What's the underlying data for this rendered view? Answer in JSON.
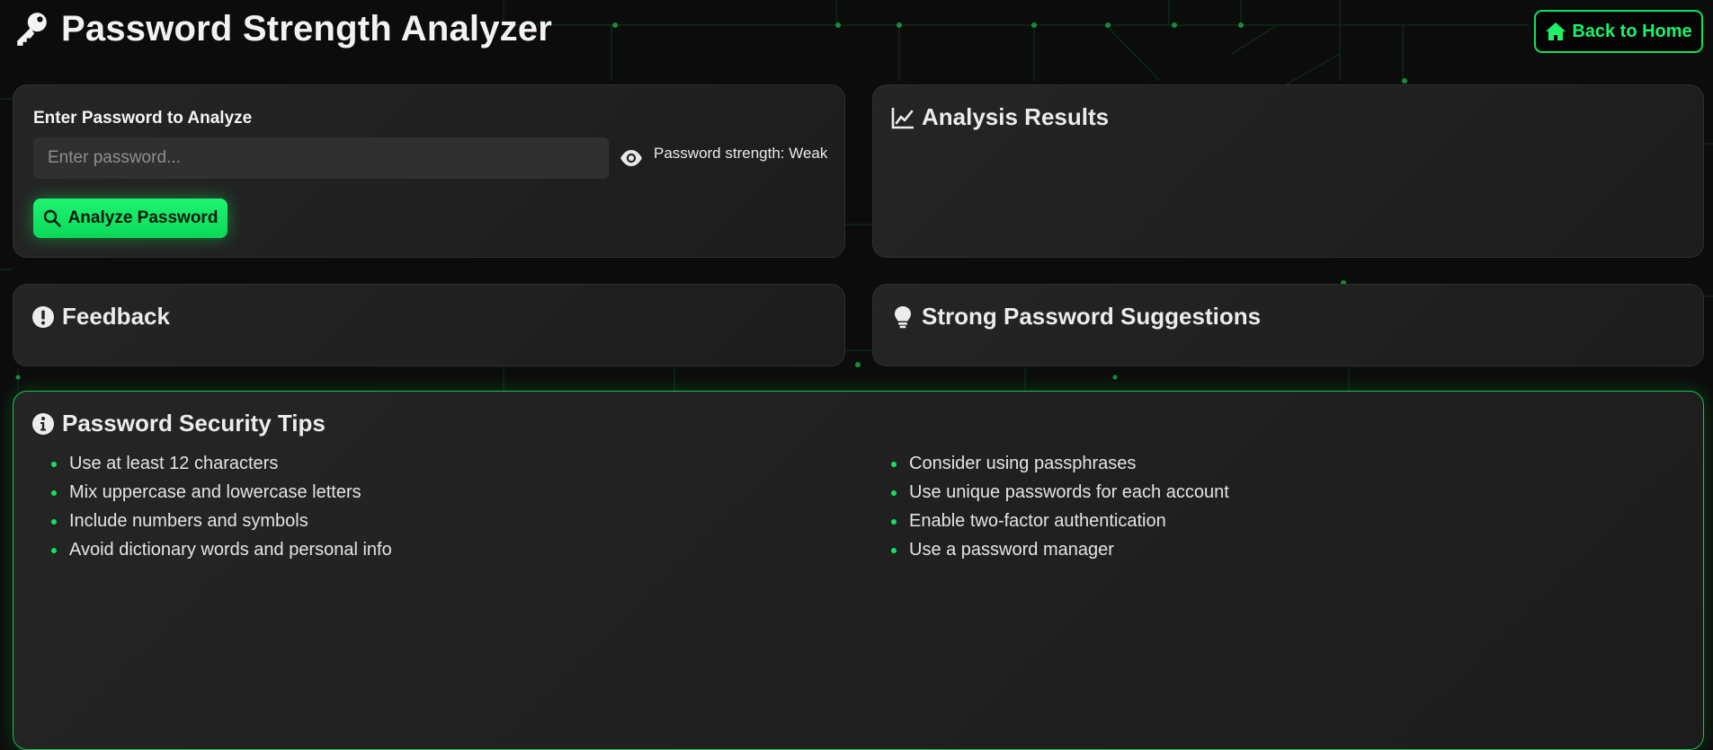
{
  "header": {
    "title": "Password Strength Analyzer",
    "back_label": "Back to Home",
    "accent_color": "#1ef06a"
  },
  "input_panel": {
    "label": "Enter Password to Analyze",
    "placeholder": "Enter password...",
    "value": "",
    "strength_text": "Password strength: Weak",
    "analyze_label": "Analyze Password"
  },
  "results": {
    "title": "Analysis Results"
  },
  "feedback": {
    "title": "Feedback"
  },
  "suggestions": {
    "title": "Strong Password Suggestions"
  },
  "tips": {
    "title": "Password Security Tips",
    "left": [
      "Use at least 12 characters",
      "Mix uppercase and lowercase letters",
      "Include numbers and symbols",
      "Avoid dictionary words and personal info"
    ],
    "right": [
      "Consider using passphrases",
      "Use unique passwords for each account",
      "Enable two-factor authentication",
      "Use a password manager"
    ]
  },
  "icons": {
    "title": "key-icon",
    "back": "home-icon",
    "visibility": "eye-icon",
    "analyze": "search-icon",
    "results": "chart-line-icon",
    "feedback": "exclamation-circle-icon",
    "suggestions": "lightbulb-icon",
    "tips": "info-circle-icon"
  }
}
